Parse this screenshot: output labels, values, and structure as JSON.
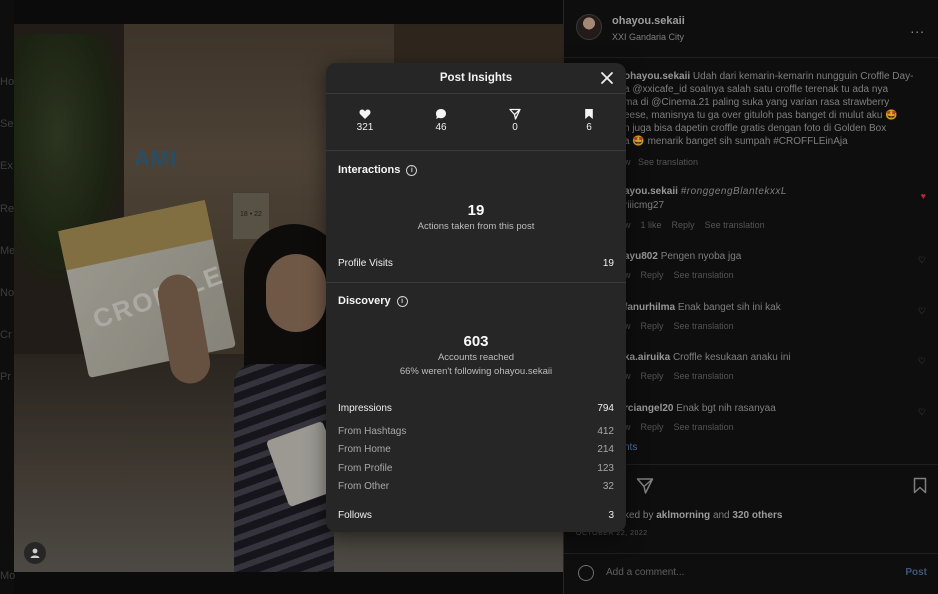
{
  "background_nav": [
    "Ho",
    "Se",
    "Ex",
    "Re",
    "Me",
    "No",
    "Cr",
    "Pr",
    "Mo"
  ],
  "photo": {
    "sign_text": "AMI",
    "board_text": "18 • 22",
    "box_text": "CROFFLE"
  },
  "post": {
    "username": "ohayou.sekaii",
    "location": "XXI Gandaria City",
    "more_label": "...",
    "caption_user": "ohayou.sekaii",
    "caption_lines": [
      "Udah dari kemarin-kemarin nungguin Croffle Day-",
      "a @xxicafe_id soalnya salah satu croffle terenak tu ada nya",
      "ma di @Cinema.21 paling suka yang varian rasa strawberry",
      "eese, manisnya tu ga over gituloh pas banget di mulut aku 🤩",
      "n juga bisa dapetin croffle gratis dengan foto di Golden Box",
      "a 🤩 menarik banget sih sumpah #CROFFLEinAja"
    ],
    "caption_meta": "w",
    "caption_see_translation": "See translation",
    "comments": [
      {
        "user": "ayou.sekaii",
        "text": "#ronggengBlantekxxL",
        "subline": "riiicmg27",
        "meta": [
          "w",
          "1 like",
          "Reply",
          "See translation"
        ],
        "liked": true
      },
      {
        "user": "ayu802",
        "text": "Pengen nyoba jga",
        "meta": [
          "w",
          "Reply",
          "See translation"
        ],
        "liked": false
      },
      {
        "user": "fanurhilma",
        "text": "Enak banget sih ini kak",
        "meta": [
          "w",
          "Reply",
          "See translation"
        ],
        "liked": false
      },
      {
        "user": "ka.airuika",
        "text": "Croffle kesukaan anaku ini",
        "meta": [
          "w",
          "Reply",
          "See translation"
        ],
        "liked": false
      },
      {
        "user": "rciangel20",
        "text": "Enak bgt nih rasanyaa",
        "meta": [
          "w",
          "Reply",
          "See translation"
        ],
        "liked": false
      }
    ],
    "comments_link": "nts",
    "liked_by_prefix": "ked by",
    "liked_by_user": "aklmorning",
    "liked_by_mid": "and",
    "liked_by_others": "320 others",
    "date": "OCTOBER 22, 2022",
    "add_comment_placeholder": "Add a comment...",
    "post_label": "Post"
  },
  "insights": {
    "title": "Post Insights",
    "stats": [
      {
        "icon": "heart-icon",
        "value": "321"
      },
      {
        "icon": "comment-icon",
        "value": "46"
      },
      {
        "icon": "share-icon",
        "value": "0"
      },
      {
        "icon": "bookmark-icon",
        "value": "6"
      }
    ],
    "interactions": {
      "title": "Interactions",
      "total": "19",
      "total_label": "Actions taken from this post",
      "profile_visits_label": "Profile Visits",
      "profile_visits": "19"
    },
    "discovery": {
      "title": "Discovery",
      "reached": "603",
      "reached_label": "Accounts reached",
      "not_following": "66% weren't following ohayou.sekaii",
      "impressions_label": "Impressions",
      "impressions": "794",
      "sources": [
        {
          "label": "From Hashtags",
          "value": "412"
        },
        {
          "label": "From Home",
          "value": "214"
        },
        {
          "label": "From Profile",
          "value": "123"
        },
        {
          "label": "From Other",
          "value": "32"
        }
      ],
      "follows_label": "Follows",
      "follows": "3"
    }
  }
}
